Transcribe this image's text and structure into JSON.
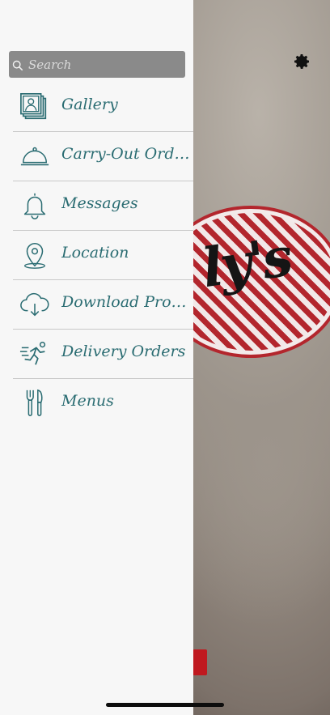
{
  "search": {
    "placeholder": "Search"
  },
  "menu": {
    "items": [
      {
        "label": "Gallery",
        "icon": "gallery-icon"
      },
      {
        "label": "Carry-Out Orders",
        "icon": "cloche-icon"
      },
      {
        "label": "Messages",
        "icon": "bell-icon"
      },
      {
        "label": "Location",
        "icon": "location-pin-icon"
      },
      {
        "label": "Download Prom...",
        "icon": "cloud-download-icon"
      },
      {
        "label": "Delivery Orders",
        "icon": "delivery-runner-icon"
      },
      {
        "label": "Menus",
        "icon": "fork-knife-icon"
      }
    ]
  },
  "background": {
    "logo_text": "ly's"
  },
  "colors": {
    "accent": "#2a6c72",
    "drawer_bg": "#f7f7f7",
    "search_bg": "#8a8a8a",
    "logo_red": "#b3262d"
  }
}
